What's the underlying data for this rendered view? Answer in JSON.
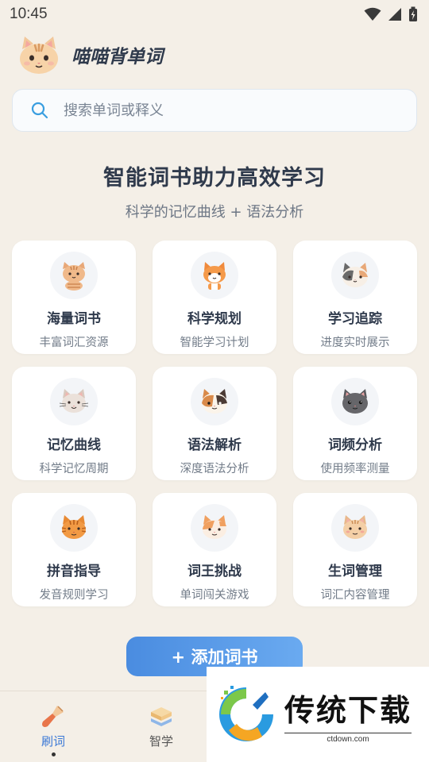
{
  "status_bar": {
    "time": "10:45"
  },
  "app": {
    "title": "喵喵背单词"
  },
  "search": {
    "placeholder": "搜索单词或释义"
  },
  "hero": {
    "title": "智能词书助力高效学习",
    "subtitle": "科学的记忆曲线 + 语法分析"
  },
  "features": [
    {
      "title": "海量词书",
      "desc": "丰富词汇资源",
      "icon": "tabby-cat-icon"
    },
    {
      "title": "科学规划",
      "desc": "智能学习计划",
      "icon": "orange-cat-icon"
    },
    {
      "title": "学习追踪",
      "desc": "进度实时展示",
      "icon": "calico-cat-icon"
    },
    {
      "title": "记忆曲线",
      "desc": "科学记忆周期",
      "icon": "gray-cat-icon"
    },
    {
      "title": "语法解析",
      "desc": "深度语法分析",
      "icon": "tricolor-cat-icon"
    },
    {
      "title": "词频分析",
      "desc": "使用频率测量",
      "icon": "dark-gray-cat-icon"
    },
    {
      "title": "拼音指导",
      "desc": "发音规则学习",
      "icon": "ginger-cat-icon"
    },
    {
      "title": "词王挑战",
      "desc": "单词闯关游戏",
      "icon": "orange-white-cat-icon"
    },
    {
      "title": "生词管理",
      "desc": "词汇内容管理",
      "icon": "beige-cat-icon"
    }
  ],
  "add_button": {
    "label": "+ 添加词书"
  },
  "tabs": [
    {
      "label": "刷词",
      "icon": "brush-icon",
      "active": true
    },
    {
      "label": "智学",
      "icon": "book-stack-icon",
      "active": false
    }
  ],
  "watermark": {
    "title": "传统下载",
    "url": "ctdown.com"
  }
}
